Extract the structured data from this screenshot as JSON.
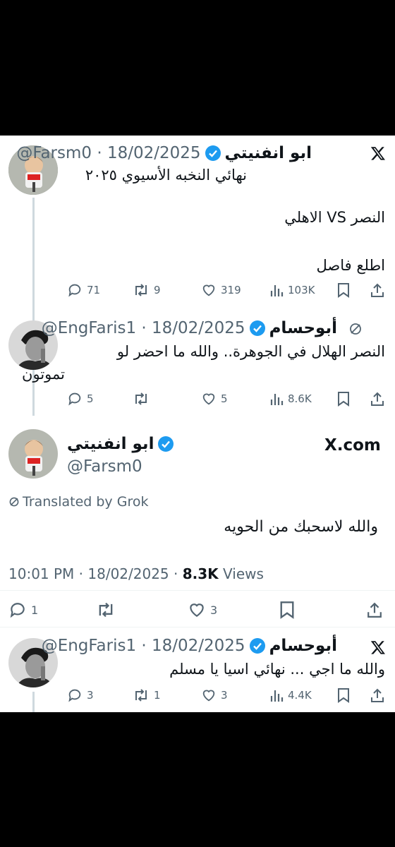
{
  "tweet1": {
    "name": "ابو انفنيتي",
    "handle_date": "@Farsm0 · 18/02/2025",
    "lines": [
      "نهائي النخبه الأسيوي ٢٠٢٥",
      "النصر VS الاهلي",
      "اطلع فاصل"
    ],
    "replies": "71",
    "reposts": "9",
    "likes": "319",
    "views": "103K"
  },
  "tweet2": {
    "name": "أبوحسام",
    "handle_date": "@EngFaris1 · 18/02/2025",
    "lines": [
      "النصر الهلال في الجوهرة.. والله ما احضر لو",
      "تموتون"
    ],
    "replies": "5",
    "reposts": "",
    "likes": "5",
    "views": "8.6K"
  },
  "main": {
    "name": "ابو انفنيتي",
    "handle": "@Farsm0",
    "brand": "X.com",
    "translated": "Translated by Grok",
    "text": "والله لاسحبك من الحويه",
    "timestamp": "10:01 PM · 18/02/2025 · ",
    "views_count": "8.3K",
    "views_label": " Views",
    "replies": "1",
    "reposts": "",
    "likes": "3"
  },
  "tweet4": {
    "name": "أبوحسام",
    "handle_date": "@EngFaris1 · 18/02/2025",
    "text": "والله ما اجي ... نهائي اسيا يا مسلم",
    "replies": "3",
    "reposts": "1",
    "likes": "3",
    "views": "4.4K"
  },
  "colors": {
    "verified": "#1d9bf0",
    "secondary": "#536471",
    "line": "#cfd9de"
  }
}
